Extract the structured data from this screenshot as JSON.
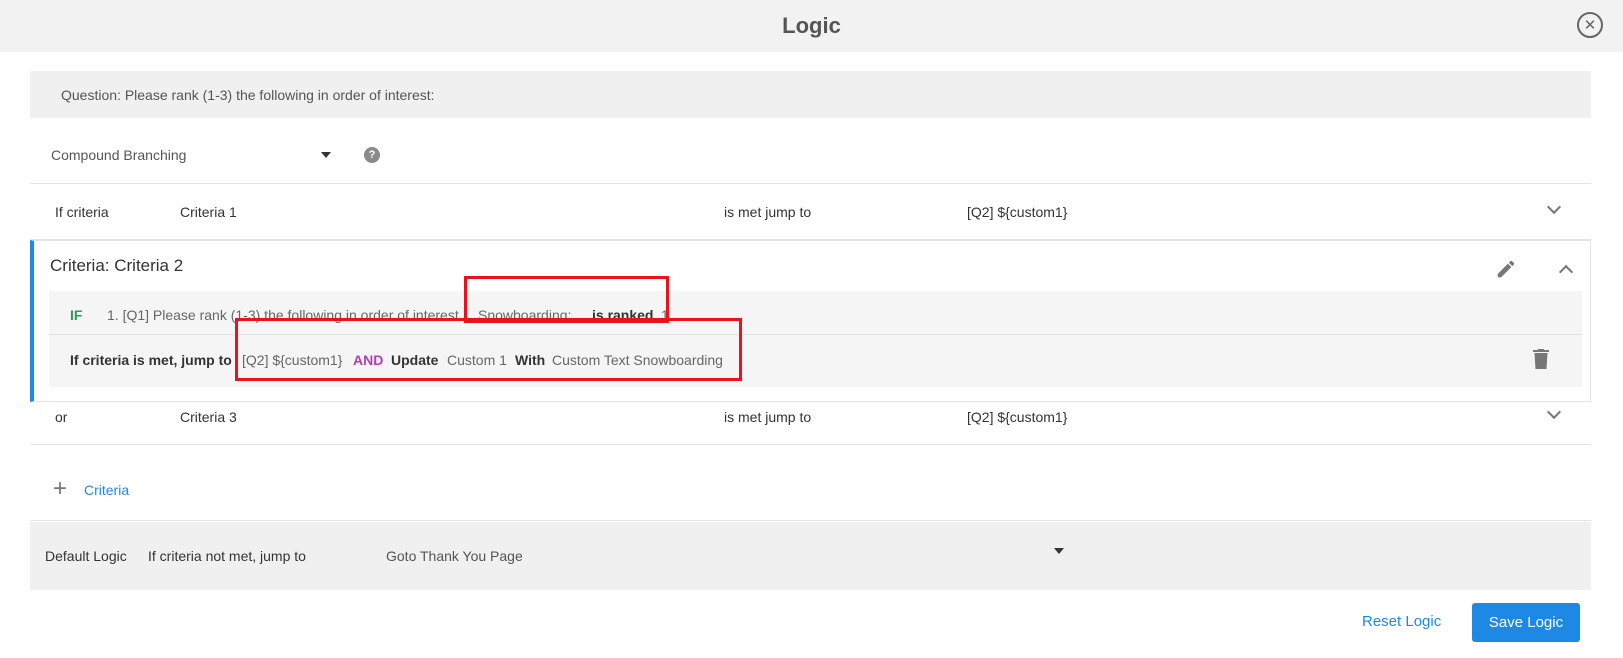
{
  "header": {
    "title": "Logic",
    "close_icon": "close-circle-icon"
  },
  "question": {
    "text": "Question: Please rank (1-3) the following in order of interest:"
  },
  "branching": {
    "selected": "Compound Branching",
    "help_icon": "question-circle-icon"
  },
  "criteria_rows": [
    {
      "prefix": "If criteria",
      "name": "Criteria 1",
      "met_label": "is met jump to",
      "target": "[Q2] ${custom1}"
    },
    {
      "prefix": "or",
      "name": "Criteria 3",
      "met_label": "is met jump to",
      "target": "[Q2] ${custom1}"
    }
  ],
  "expanded": {
    "title": "Criteria: Criteria 2",
    "if_keyword": "IF",
    "question": "1. [Q1] Please rank (1-3) the following in order of interest",
    "answer": "Snowboarding;",
    "operator": "is ranked",
    "value": "1",
    "then_label": "If criteria is met, jump to",
    "then_target": "[Q2] ${custom1}",
    "and_keyword": "AND",
    "update_label": "Update",
    "update_field": "Custom 1",
    "with_label": "With",
    "with_text": "Custom Text Snowboarding"
  },
  "add_criteria": {
    "label": "Criteria"
  },
  "default_logic": {
    "label": "Default Logic",
    "condition": "If criteria not met, jump to",
    "target": "Goto Thank You Page"
  },
  "footer": {
    "reset_label": "Reset Logic",
    "save_label": "Save Logic"
  },
  "colors": {
    "accent": "#1e88e5",
    "highlight": "#e8141c",
    "if_green": "#2e9b55",
    "and_purple": "#b03fb0"
  }
}
